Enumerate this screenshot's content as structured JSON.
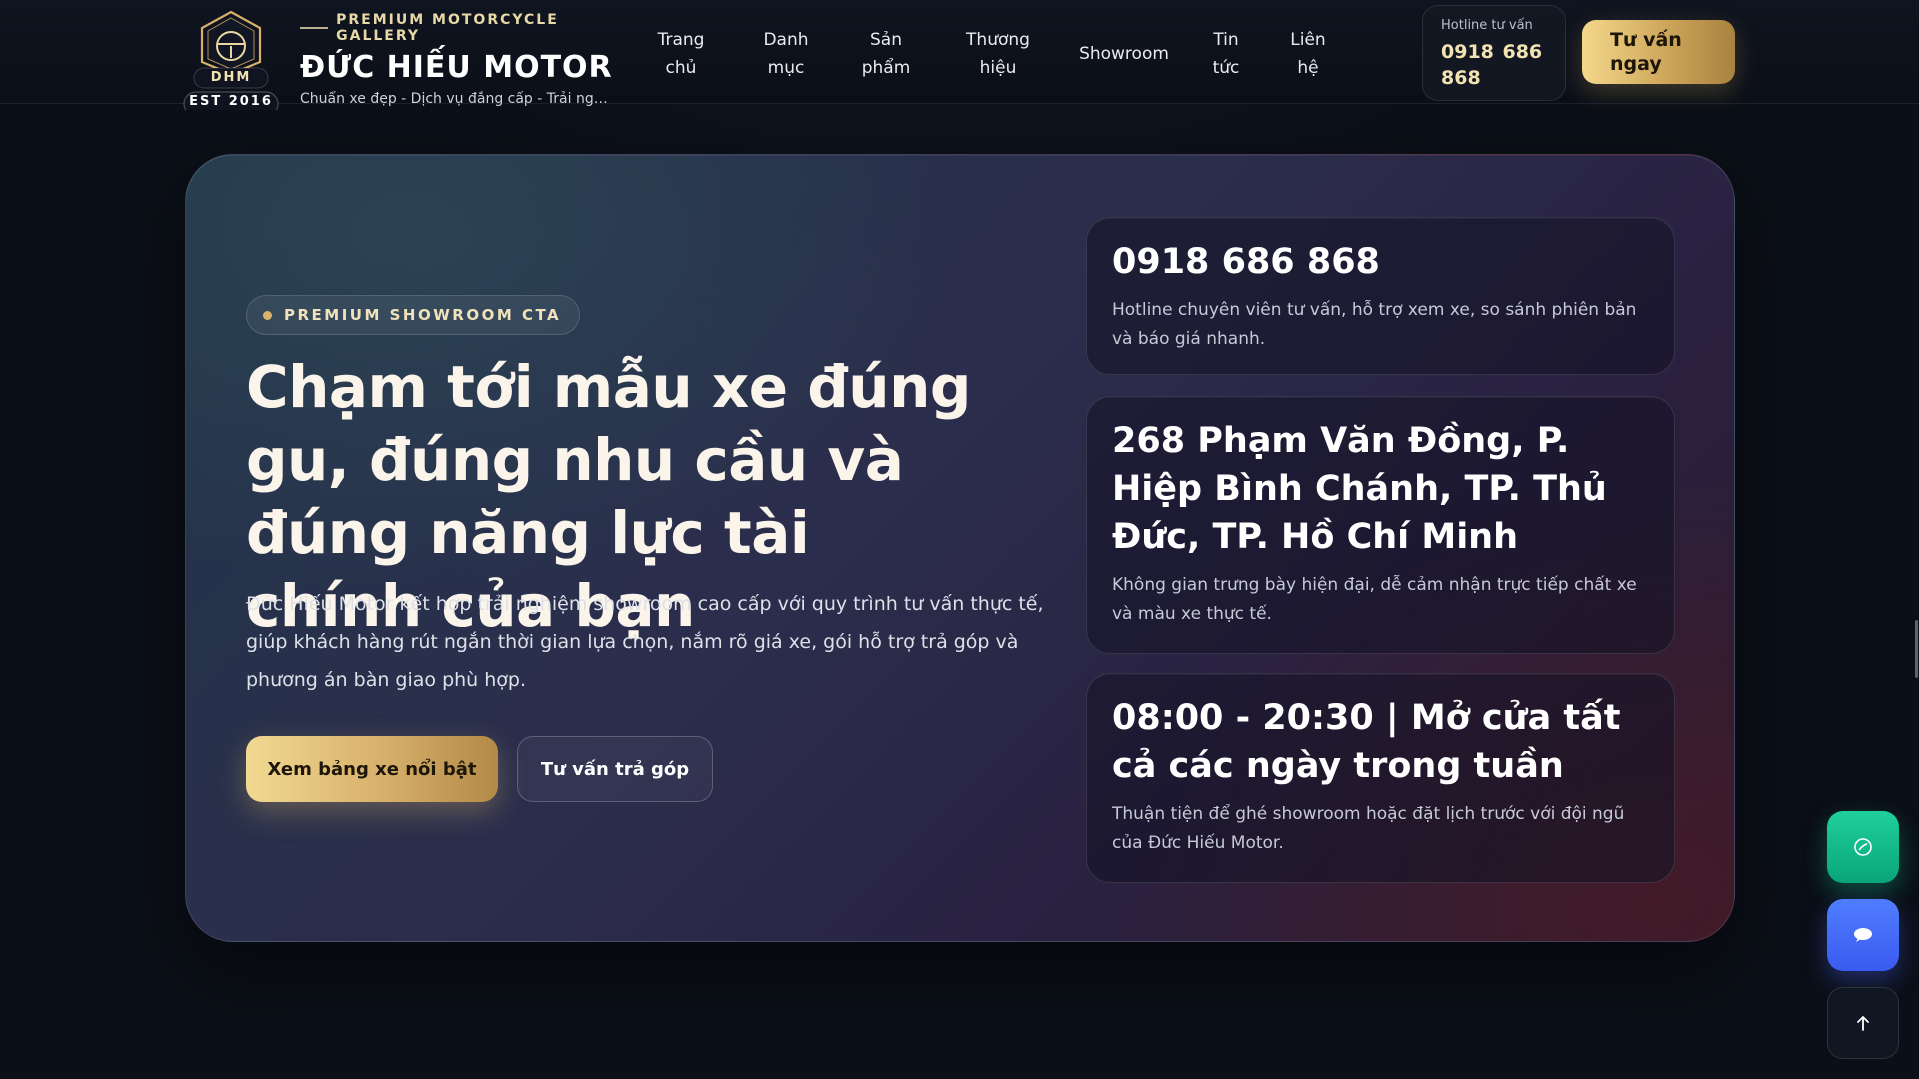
{
  "header": {
    "logo": {
      "monogram": "DHM",
      "est": "EST 2016",
      "icon": "steering-wheel-crest-icon"
    },
    "tagline": "PREMIUM MOTORCYCLE GALLERY",
    "brand_name": "ĐỨC HIẾU MOTOR",
    "brand_sub": "Chuẩn xe đẹp - Dịch vụ đẳng cấp - Trải nghiệ...",
    "nav": [
      {
        "label": "Trang chủ"
      },
      {
        "label": "Danh mục"
      },
      {
        "label": "Sản phẩm"
      },
      {
        "label": "Thương hiệu"
      },
      {
        "label": "Showroom"
      },
      {
        "label": "Tin tức"
      },
      {
        "label": "Liên hệ"
      }
    ],
    "hotline": {
      "label": "Hotline tư vấn",
      "number": "0918 686 868"
    },
    "consult_button": "Tư vấn ngay"
  },
  "cta": {
    "badge": "PREMIUM SHOWROOM CTA",
    "headline": "Chạm tới mẫu xe đúng gu, đúng nhu cầu và đúng năng lực tài chính của bạn",
    "description": "Đức Hiếu Motor kết hợp trải nghiệm showroom cao cấp với quy trình tư vấn thực tế, giúp khách hàng rút ngắn thời gian lựa chọn, nắm rõ giá xe, gói hỗ trợ trả góp và phương án bàn giao phù hợp.",
    "primary_button": "Xem bảng xe nổi bật",
    "secondary_button": "Tư vấn trả góp",
    "cards": [
      {
        "title": "0918 686 868",
        "text": "Hotline chuyên viên tư vấn, hỗ trợ xem xe, so sánh phiên bản và báo giá nhanh."
      },
      {
        "title": "268 Phạm Văn Đồng, P. Hiệp Bình Chánh, TP. Thủ Đức, TP. Hồ Chí Minh",
        "text": "Không gian trưng bày hiện đại, dễ cảm nhận trực tiếp chất xe và màu xe thực tế."
      },
      {
        "title": "08:00 - 20:30 | Mở cửa tất cả các ngày trong tuần",
        "text": "Thuận tiện để ghé showroom hoặc đặt lịch trước với đội ngũ của Đức Hiếu Motor."
      }
    ]
  },
  "floating": {
    "phone_icon": "phone-icon",
    "chat_icon": "chat-bubble-icon",
    "top_icon": "arrow-up-icon"
  },
  "colors": {
    "gold": "#d6b06a",
    "background": "#0b0f17",
    "green": "#14c08f",
    "blue": "#4a6ff8"
  }
}
